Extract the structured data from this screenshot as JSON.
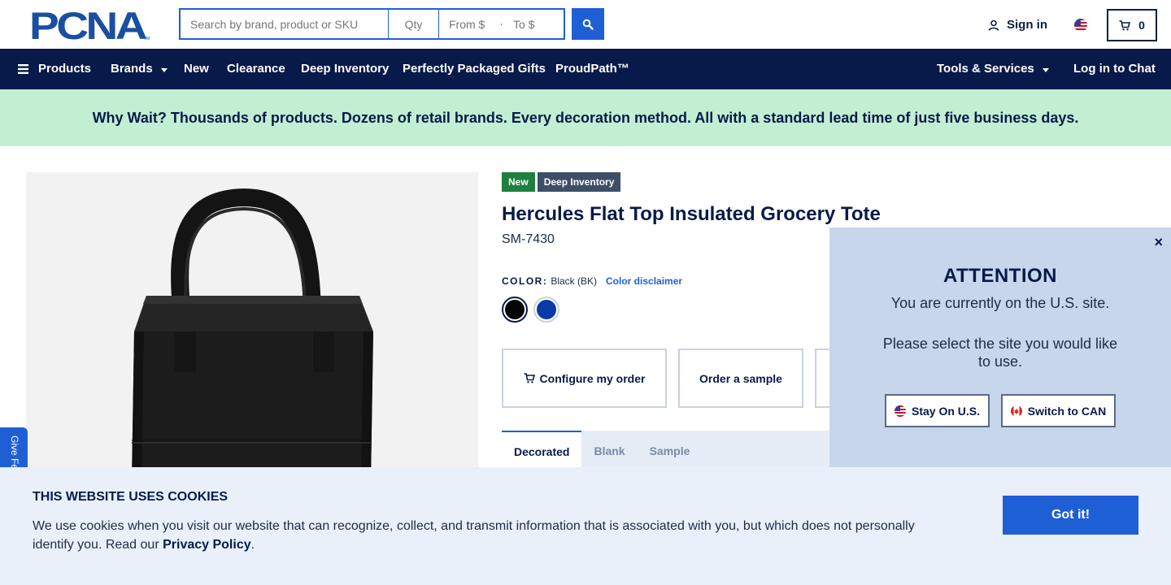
{
  "header": {
    "logo_text": "PCNA",
    "search": {
      "placeholder": "Search by brand, product or SKU",
      "value": ""
    },
    "qty": {
      "placeholder": "Qty",
      "value": ""
    },
    "price_from": {
      "placeholder": "From $",
      "value": ""
    },
    "price_to": {
      "placeholder": "To $",
      "value": ""
    },
    "sign_in_label": "Sign in",
    "cart_count": "0"
  },
  "nav": {
    "products": "Products",
    "brands": "Brands",
    "new": "New",
    "clearance": "Clearance",
    "deep_inventory": "Deep Inventory",
    "gifts": "Perfectly Packaged Gifts",
    "proudpath": "ProudPath™",
    "tools": "Tools & Services",
    "chat": "Log in to Chat"
  },
  "banner": {
    "text": "Why Wait? Thousands of products. Dozens of retail brands. Every decoration method. All with a standard lead time of just five business days."
  },
  "product": {
    "badges": {
      "new": "New",
      "deep": "Deep Inventory"
    },
    "title": "Hercules Flat Top Insulated Grocery Tote",
    "sku": "SM-7430",
    "color_label": "COLOR:",
    "color_value": "Black (BK)",
    "color_disclaimer": "Color disclaimer",
    "swatches": [
      {
        "name": "Black",
        "hex": "#050505"
      },
      {
        "name": "Royal Blue",
        "hex": "#0a3aa8"
      }
    ],
    "buttons": {
      "configure": "Configure my order",
      "sample": "Order a sample"
    },
    "tabs": [
      "Decorated",
      "Blank",
      "Sample"
    ]
  },
  "feedback_label": "Give Feedback",
  "attention": {
    "close": "×",
    "title": "ATTENTION",
    "line1": "You are currently on the U.S. site.",
    "line2": "Please select the site you would like to use.",
    "stay_label": "Stay On U.S.",
    "switch_label": "Switch to CAN"
  },
  "cookie": {
    "title": "THIS WEBSITE USES COOKIES",
    "text": "We use cookies when you visit our website that can recognize, collect, and transmit information that is associated with you, but which does not personally identify you. Read our ",
    "link": "Privacy Policy",
    "period": ".",
    "button": "Got it!"
  },
  "colors": {
    "brand_blue": "#1f5fd6",
    "navy": "#071a4a",
    "banner_green": "#c2efd2",
    "badge_new": "#1e7f3e",
    "badge_deep": "#3d4e66"
  }
}
